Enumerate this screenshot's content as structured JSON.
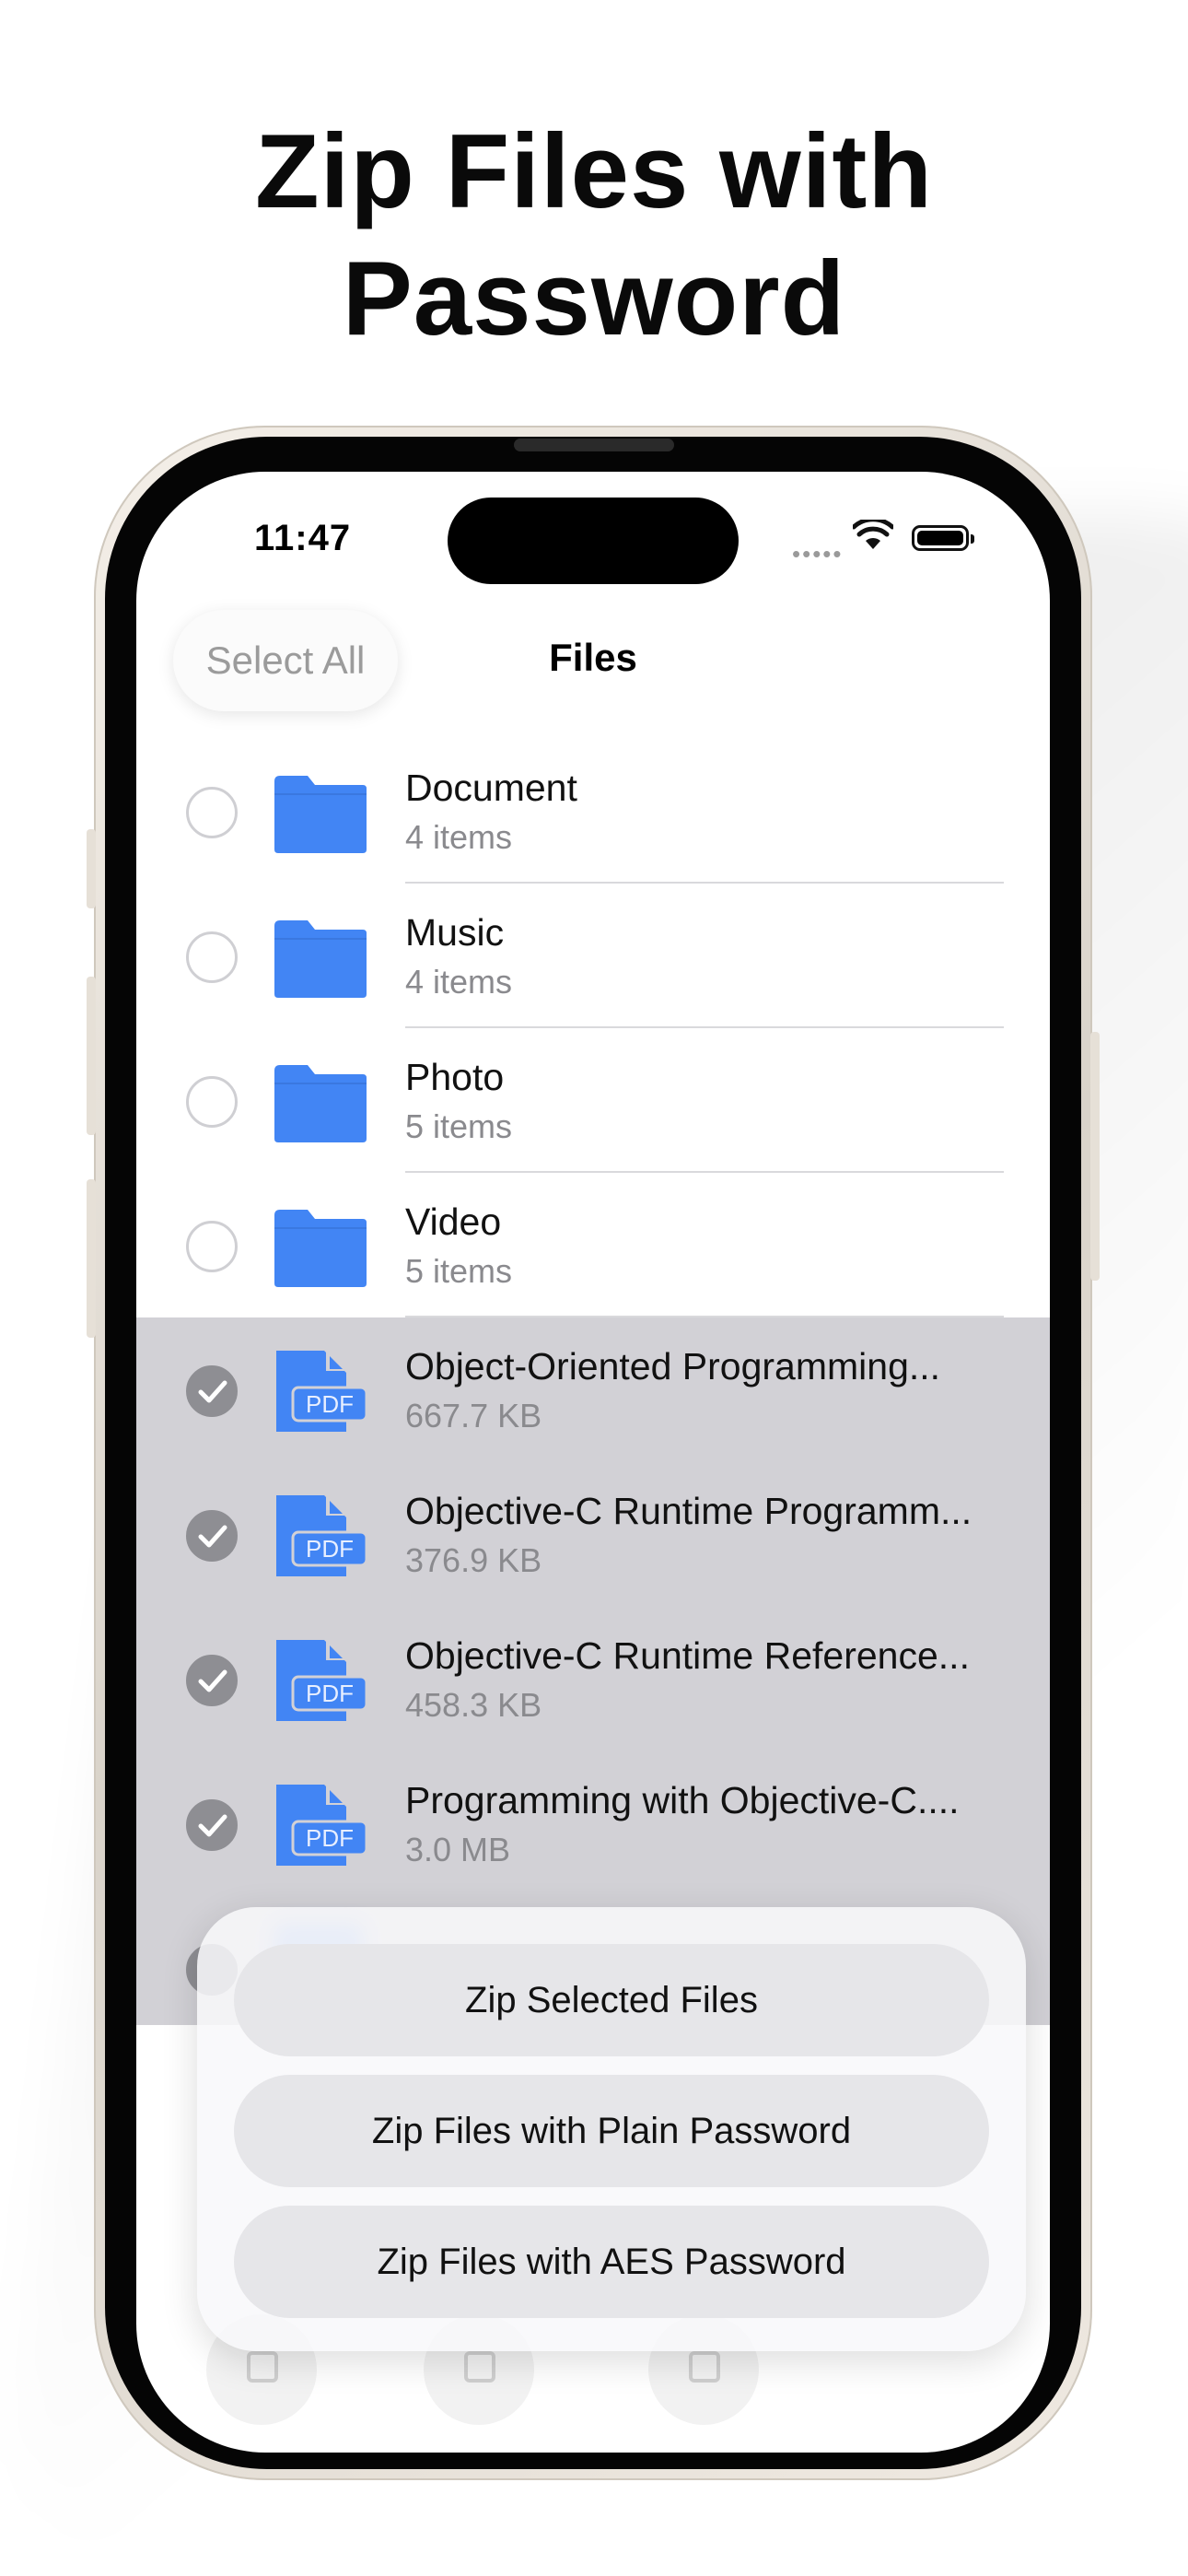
{
  "headline": {
    "line1": "Zip Files with",
    "line2": "Password"
  },
  "status_bar": {
    "time": "11:47",
    "more_dots": "•••••"
  },
  "nav": {
    "select_all": "Select All",
    "title": "Files"
  },
  "folders": [
    {
      "name": "Document",
      "sub": "4 items"
    },
    {
      "name": "Music",
      "sub": "4 items"
    },
    {
      "name": "Photo",
      "sub": "5 items"
    },
    {
      "name": "Video",
      "sub": "5 items"
    }
  ],
  "files": [
    {
      "name": "Object-Oriented Programming...",
      "sub": "667.7 KB",
      "badge": "PDF"
    },
    {
      "name": "Objective-C Runtime Programm...",
      "sub": "376.9 KB",
      "badge": "PDF"
    },
    {
      "name": "Objective-C Runtime Reference...",
      "sub": "458.3 KB",
      "badge": "PDF"
    },
    {
      "name": "Programming with Objective-C....",
      "sub": "3.0 MB",
      "badge": "PDF"
    }
  ],
  "action_sheet": {
    "zip_selected": "Zip Selected Files",
    "zip_plain": "Zip Files with Plain Password",
    "zip_aes": "Zip Files with AES Password"
  },
  "colors": {
    "accent": "#4285f4",
    "selected_row": "#d2d1d6"
  }
}
